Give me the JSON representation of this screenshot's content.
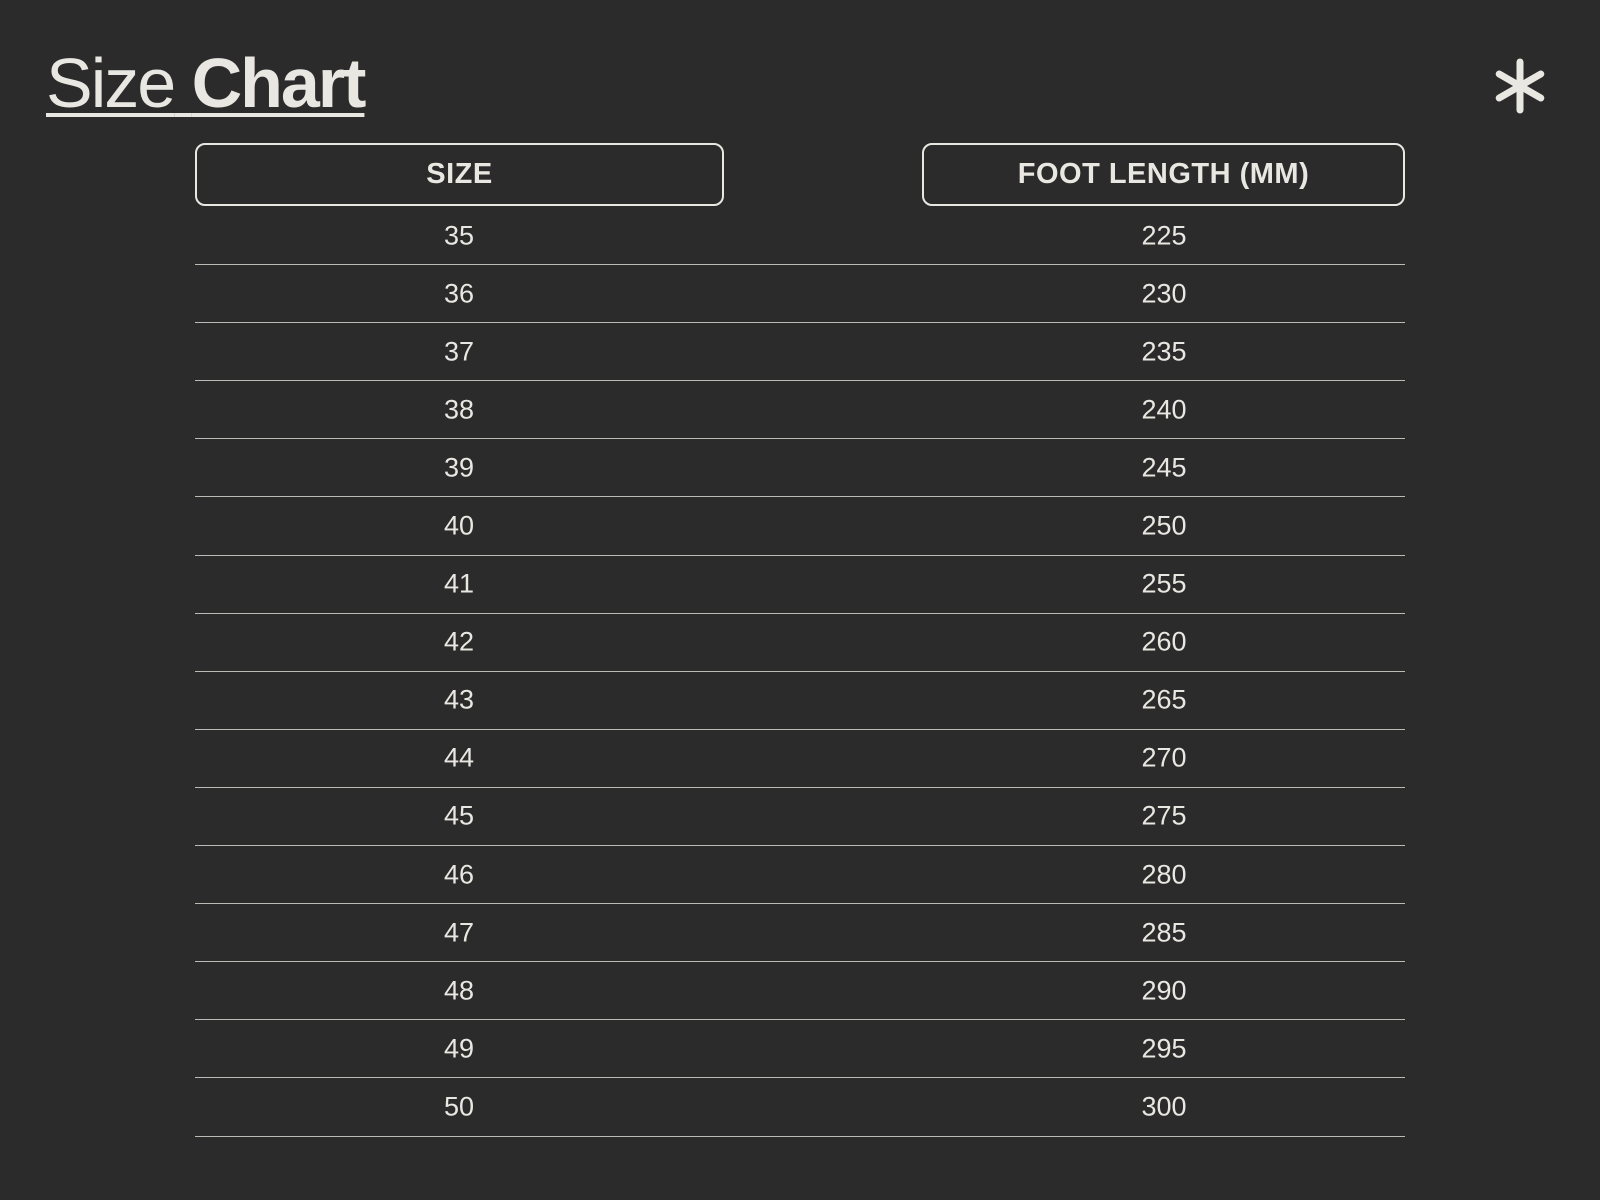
{
  "title": {
    "light": "Size",
    "bold": "Chart"
  },
  "icons": {
    "corner": "asterisk-icon"
  },
  "colors": {
    "background": "#2b2b2b",
    "foreground": "#e9e7e2",
    "rule": "#bdbbb6"
  },
  "table": {
    "headers": [
      "SIZE",
      "FOOT LENGTH (MM)"
    ],
    "rows": [
      [
        "35",
        "225"
      ],
      [
        "36",
        "230"
      ],
      [
        "37",
        "235"
      ],
      [
        "38",
        "240"
      ],
      [
        "39",
        "245"
      ],
      [
        "40",
        "250"
      ],
      [
        "41",
        "255"
      ],
      [
        "42",
        "260"
      ],
      [
        "43",
        "265"
      ],
      [
        "44",
        "270"
      ],
      [
        "45",
        "275"
      ],
      [
        "46",
        "280"
      ],
      [
        "47",
        "285"
      ],
      [
        "48",
        "290"
      ],
      [
        "49",
        "295"
      ],
      [
        "50",
        "300"
      ]
    ]
  }
}
